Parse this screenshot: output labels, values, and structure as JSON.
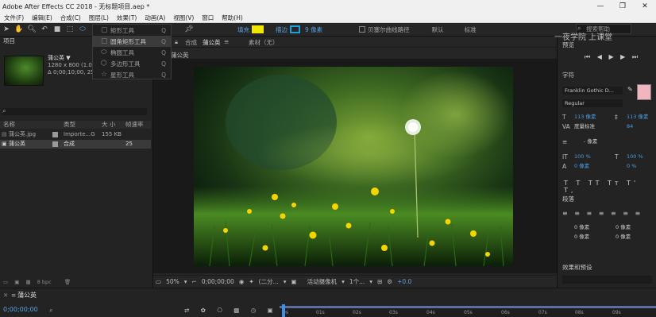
{
  "window": {
    "title": "Adobe After Effects CC 2018 - 无标题项目.aep *",
    "minimize": "—",
    "maximize": "❐",
    "close": "✕"
  },
  "menu": [
    "文件(F)",
    "编辑(E)",
    "合成(C)",
    "图层(L)",
    "效果(T)",
    "动画(A)",
    "视图(V)",
    "窗口",
    "帮助(H)"
  ],
  "toolbar": {
    "fill_label": "填充",
    "stroke_label": "描边",
    "stroke_size": "9 像素",
    "bezier_label": "贝塞尔曲线路径",
    "default_label": "默认",
    "standard_label": "标准",
    "search_placeholder": "搜索帮助",
    "fill_color": "#f2e600",
    "stroke_color": "#1da0e0"
  },
  "shape_menu": {
    "items": [
      {
        "label": "矩形工具",
        "key": "Q",
        "icon": "rectangle-icon"
      },
      {
        "label": "圆角矩形工具",
        "key": "Q",
        "icon": "rounded-rectangle-icon"
      },
      {
        "label": "椭圆工具",
        "key": "Q",
        "icon": "ellipse-icon"
      },
      {
        "label": "多边形工具",
        "key": "Q",
        "icon": "polygon-icon"
      },
      {
        "label": "星形工具",
        "key": "Q",
        "icon": "star-icon"
      }
    ]
  },
  "watermark": "一夜学院 上课堂",
  "project": {
    "tab": "项目",
    "asset_name": "蒲公英 ▼",
    "resolution": "1280 x 800 (1.00)",
    "duration": "Δ 0;00;10;00, 25.00 fps",
    "columns": {
      "name": "名称",
      "type": "类型",
      "size": "大 小",
      "fps": "帧速率"
    },
    "items": [
      {
        "name": "蒲公英.jpg",
        "type": "Importe...G",
        "size": "155 KB",
        "fps": "",
        "selected": false
      },
      {
        "name": "蒲公英",
        "type": "合成",
        "size": "",
        "fps": "25",
        "selected": true
      }
    ],
    "bpc": "8 bpc"
  },
  "comp": {
    "tab_comp": "合成",
    "tab_name": "蒲公英",
    "tab_footage": "素材（无）",
    "breadcrumb": "蒲公英",
    "zoom": "50%",
    "timecode": "0;00;00;00",
    "resolution": "(二分...",
    "camera": "活动摄像机",
    "views": "1个...",
    "exposure": "+0.0"
  },
  "right": {
    "preview": "预览",
    "character": "字符",
    "font": "Franklin Gothic D...",
    "style": "Regular",
    "font_size": "113 像素",
    "leading": "113 像素",
    "tracking_mode": "度量标准",
    "tracking": "84",
    "stroke_width": "- 像素",
    "vscale": "100 %",
    "hscale": "100 %",
    "baseline": "0 像素",
    "tsume": "0 %",
    "paragraph": "段落",
    "para_indent_left": "0 像素",
    "para_indent_right": "0 像素",
    "para_indent_first": "0 像素",
    "para_space_before": "0 像素",
    "para_space_after": "0 像素",
    "effects": "效果和预设",
    "fill_swatch": "#f2b4be"
  },
  "timeline": {
    "tab": "蒲公英",
    "timecode": "0;00;00;00",
    "ticks": [
      "0s",
      "01s",
      "02s",
      "03s",
      "04s",
      "05s",
      "06s",
      "07s",
      "08s",
      "09s"
    ]
  }
}
